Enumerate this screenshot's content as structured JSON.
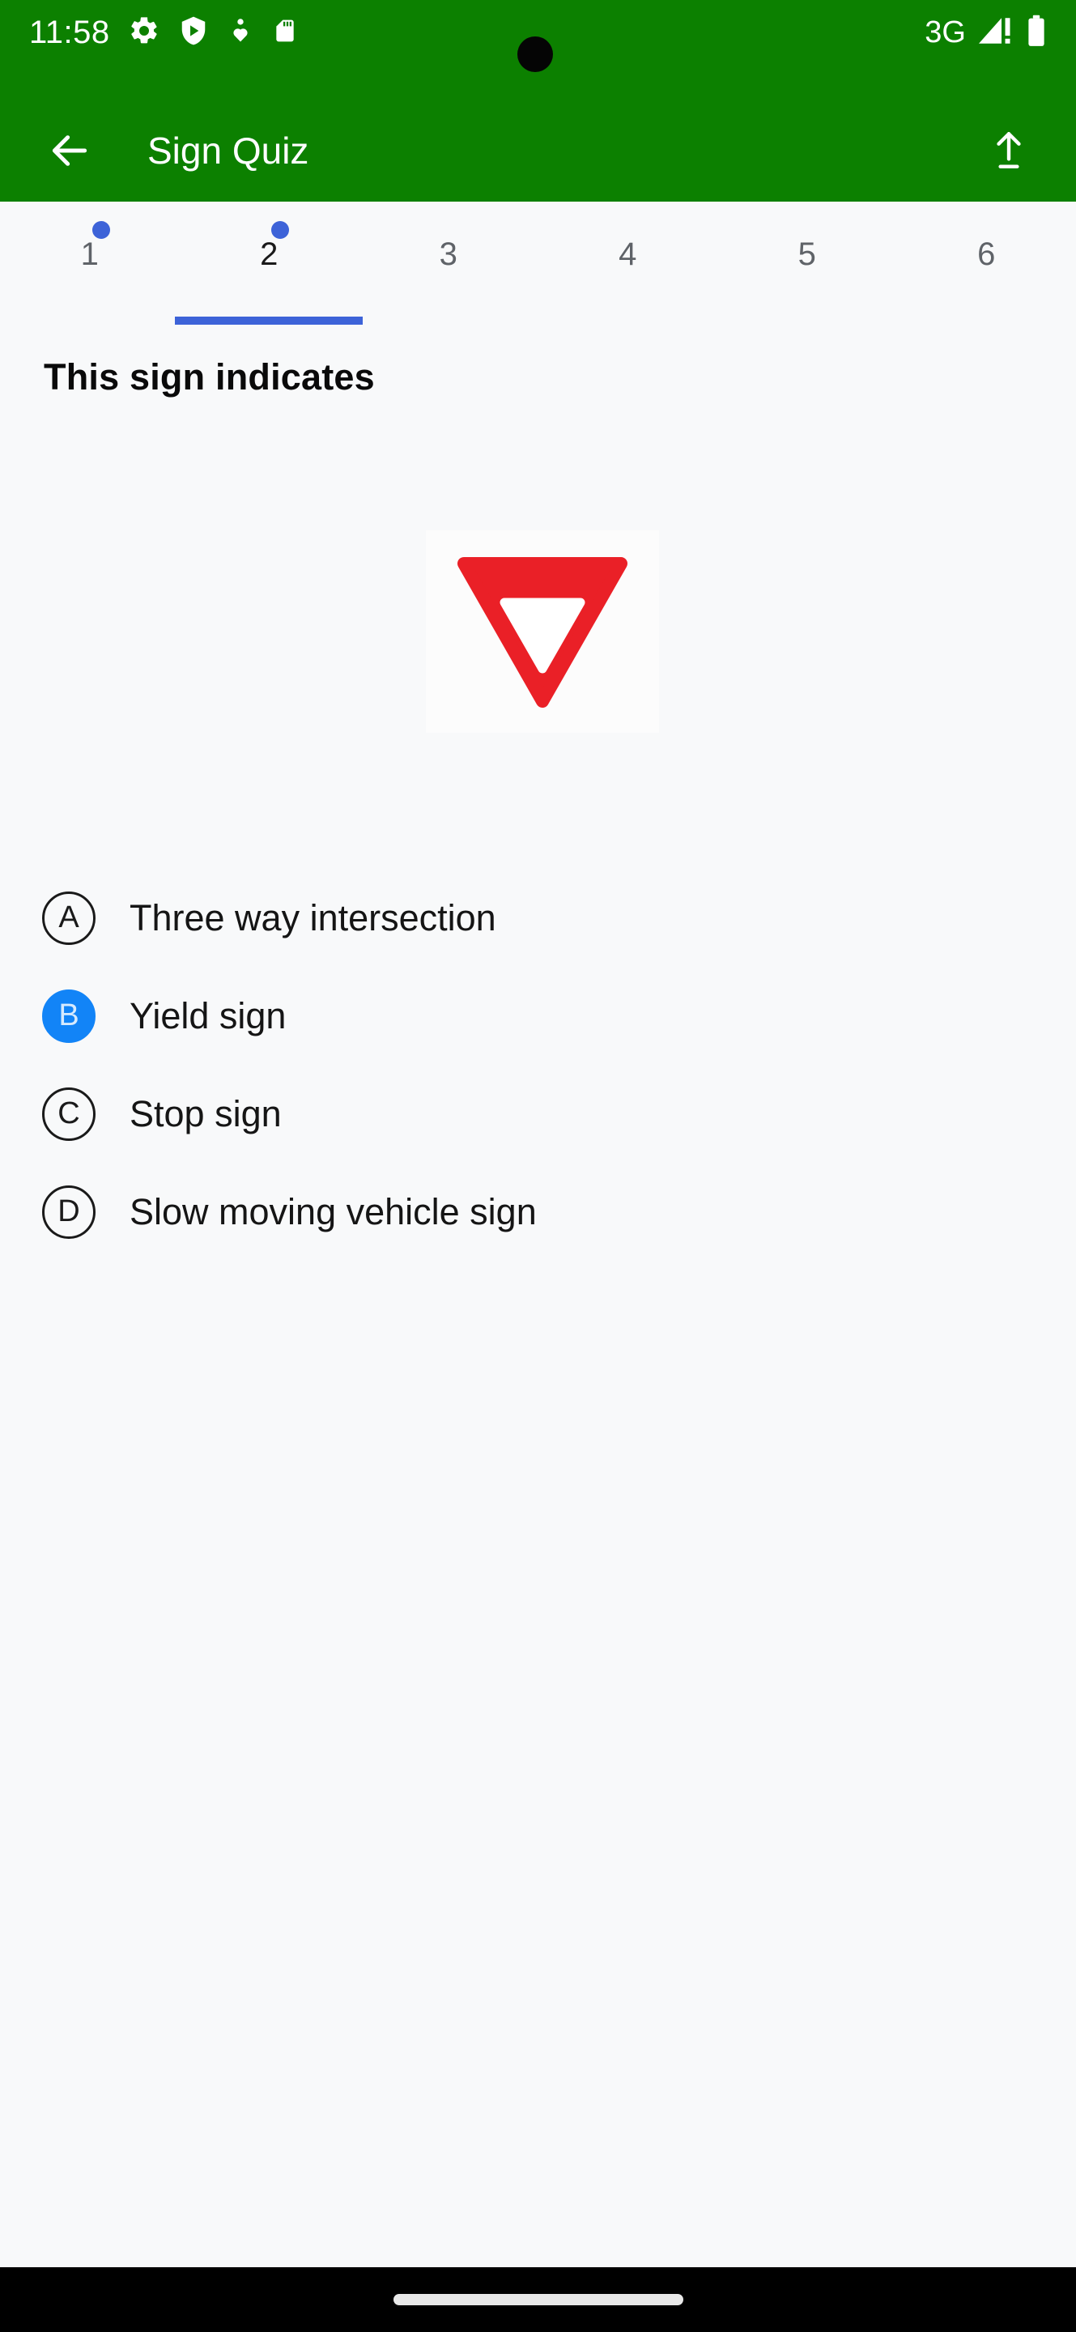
{
  "status_bar": {
    "time": "11:58",
    "network_type": "3G",
    "icons": [
      {
        "name": "gear-icon",
        "label": "Settings"
      },
      {
        "name": "play-protect-shield-icon",
        "label": "Play Protect"
      },
      {
        "name": "accessibility-person-icon",
        "label": "Accessibility"
      },
      {
        "name": "sd-card-icon",
        "label": "SD card"
      }
    ],
    "right_icons": [
      {
        "name": "cellular-signal-alert-icon",
        "label": "Signal no internet"
      },
      {
        "name": "battery-full-icon",
        "label": "Battery"
      }
    ],
    "background_color": "#0C8000",
    "foreground_color": "#FFFFFF"
  },
  "app_bar": {
    "title": "Sign Quiz",
    "back_label": "Back",
    "upload_label": "Share",
    "background_color": "#0C8000"
  },
  "tabs": {
    "active_index": 1,
    "indicator_color": "#3D63D8",
    "dot_color": "#3D63D8",
    "items": [
      {
        "label": "1",
        "answered": true,
        "active": false
      },
      {
        "label": "2",
        "answered": true,
        "active": true
      },
      {
        "label": "3",
        "answered": false,
        "active": false
      },
      {
        "label": "4",
        "answered": false,
        "active": false
      },
      {
        "label": "5",
        "answered": false,
        "active": false
      },
      {
        "label": "6",
        "answered": false,
        "active": false
      }
    ]
  },
  "question": {
    "prompt": "This sign indicates",
    "image": {
      "name": "yield-sign-image",
      "description": "Red inverted triangle yield sign",
      "sign_color": "#EA2027",
      "background_color": "#FCFCFC"
    }
  },
  "options": [
    {
      "letter": "A",
      "text": "Three way intersection",
      "selected": false
    },
    {
      "letter": "B",
      "text": "Yield sign",
      "selected": true
    },
    {
      "letter": "C",
      "text": "Stop sign",
      "selected": false
    },
    {
      "letter": "D",
      "text": "Slow moving vehicle sign",
      "selected": false
    }
  ],
  "selected_badge_color": "#1284F7",
  "nav_bar": {
    "home_indicator_label": "Home",
    "background_color": "#000000"
  }
}
